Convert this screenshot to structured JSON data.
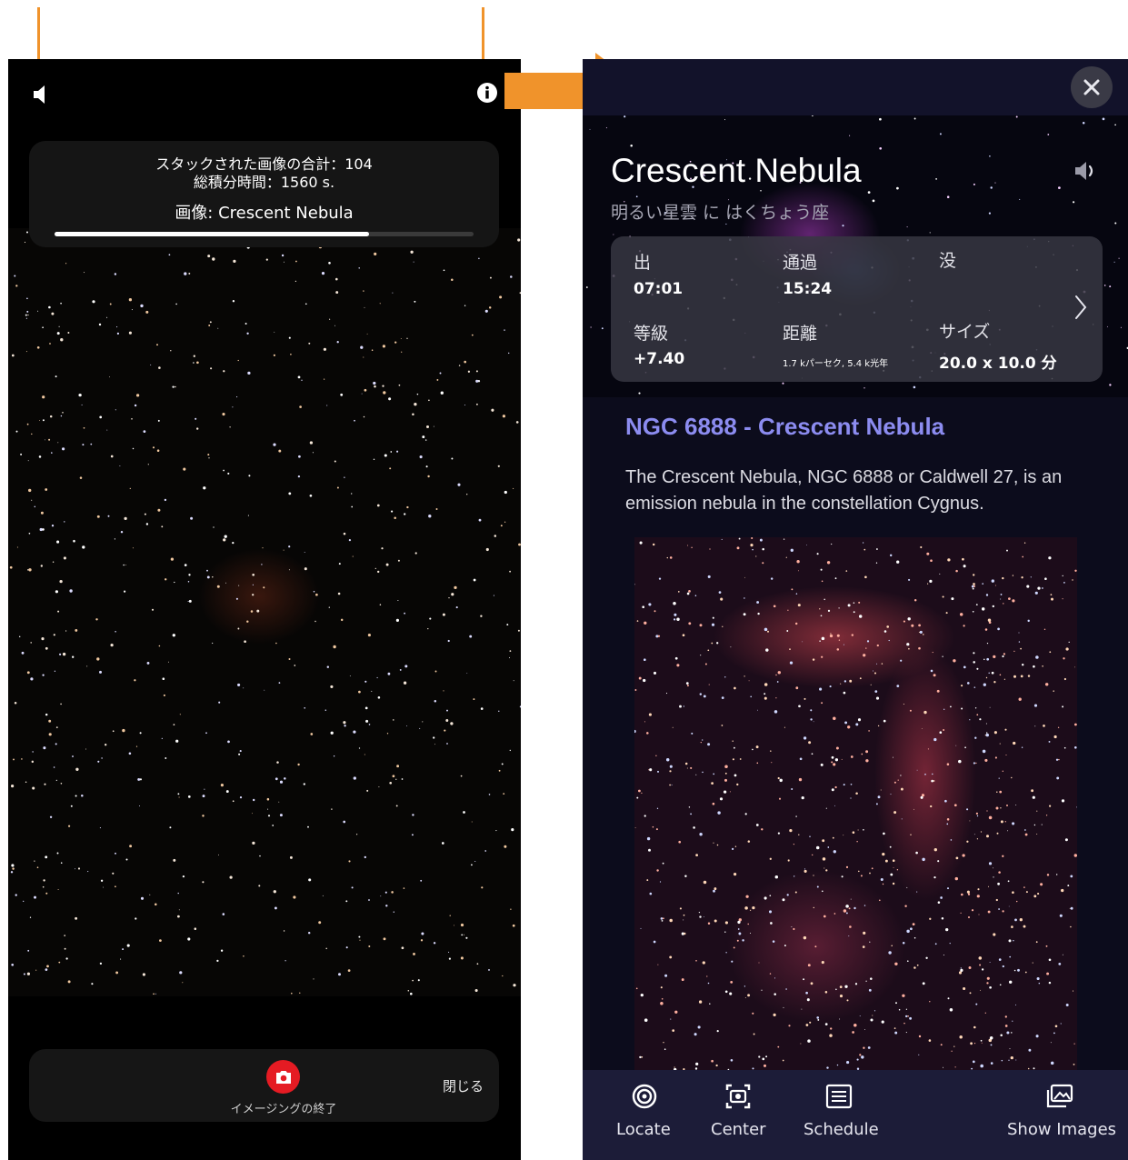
{
  "left": {
    "stacking": {
      "total_label": "スタックされた画像の合計：104",
      "integration_label": "総積分時間：1560 s.",
      "image_label": "画像: Crescent Nebula",
      "progress_percent": 75
    },
    "bottom": {
      "stop_label": "イメージングの終了",
      "close_label": "閉じる"
    }
  },
  "right": {
    "title": "Crescent Nebula",
    "subtitle": "明るい星雲 に はくちょう座",
    "info": {
      "rise_label": "出",
      "rise_value": "07:01",
      "transit_label": "通過",
      "transit_value": "15:24",
      "set_label": "没",
      "magnitude_label": "等級",
      "magnitude_value": "+7.40",
      "distance_label": "距離",
      "distance_value": "1.7 kパーセク, 5.4 k光年",
      "size_label": "サイズ",
      "size_value": "20.0 x 10.0 分"
    },
    "description": {
      "title": "NGC 6888 - Crescent Nebula",
      "text": "The Crescent Nebula, NGC 6888 or Caldwell 27, is an emission nebula in the constellation Cygnus."
    },
    "toolbar": {
      "locate": "Locate",
      "center": "Center",
      "schedule": "Schedule",
      "show_images": "Show Images"
    }
  },
  "colors": {
    "accent_orange": "#f0932b",
    "stop_red": "#e51b23",
    "title_purple": "#8c8cf0"
  }
}
